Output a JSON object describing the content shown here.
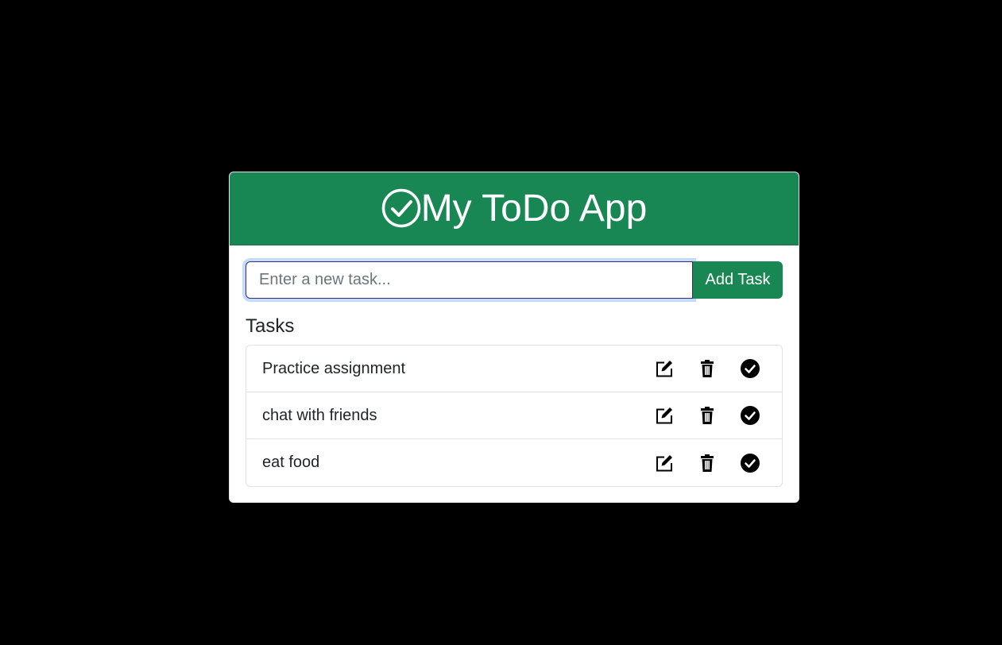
{
  "header": {
    "title": "My ToDo App",
    "icon": "check-circle-icon",
    "bg_color": "#198754"
  },
  "form": {
    "input_placeholder": "Enter a new task...",
    "input_value": "",
    "add_button_label": "Add Task"
  },
  "tasks_section": {
    "title": "Tasks",
    "items": [
      {
        "label": "Practice assignment",
        "icons": [
          "edit-icon",
          "trash-icon",
          "check-circle-fill-icon"
        ]
      },
      {
        "label": "chat with friends",
        "icons": [
          "edit-icon",
          "trash-icon",
          "check-circle-fill-icon"
        ]
      },
      {
        "label": "eat food",
        "icons": [
          "edit-icon",
          "trash-icon",
          "check-circle-fill-icon"
        ]
      }
    ]
  }
}
